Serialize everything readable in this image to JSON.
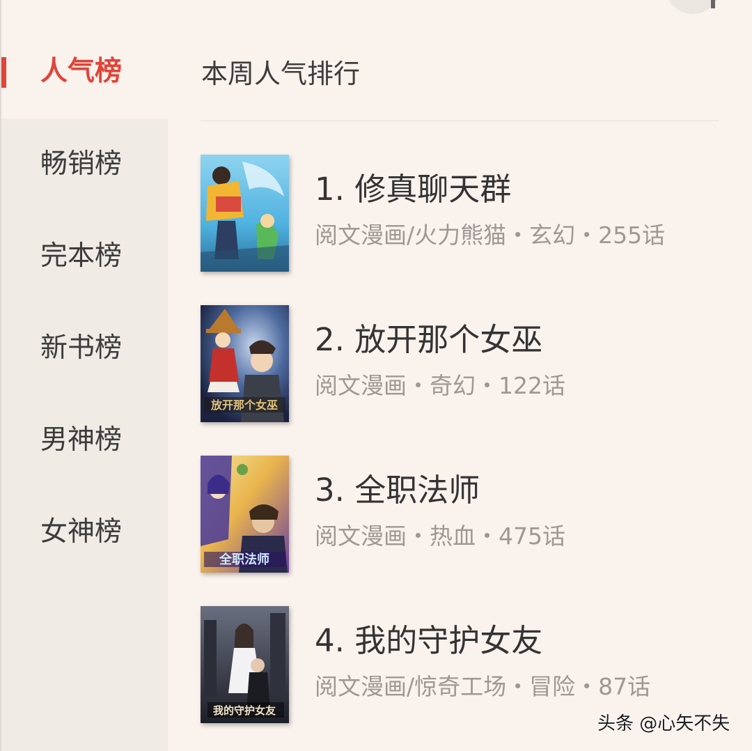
{
  "sidebar": {
    "items": [
      {
        "label": "人气榜",
        "active": true
      },
      {
        "label": "畅销榜"
      },
      {
        "label": "完本榜"
      },
      {
        "label": "新书榜"
      },
      {
        "label": "男神榜"
      },
      {
        "label": "女神榜"
      }
    ]
  },
  "header": {
    "title": "本周人气排行"
  },
  "list": [
    {
      "title": "1. 修真聊天群",
      "meta": "阅文漫画/火力熊猫・玄幻・255话"
    },
    {
      "title": "2. 放开那个女巫",
      "meta": "阅文漫画・奇幻・122话",
      "cover_text": "放开那个女巫"
    },
    {
      "title": "3. 全职法师",
      "meta": "阅文漫画・热血・475话",
      "cover_text": "全职法师"
    },
    {
      "title": "4. 我的守护女友",
      "meta": "阅文漫画/惊奇工场・冒险・87话",
      "cover_text": "我的守护女友"
    }
  ],
  "watermark": "头条 @心矢不失",
  "colors": {
    "accent": "#e0453a",
    "background": "#faf2ed",
    "sidebar": "#f1ebe6"
  }
}
